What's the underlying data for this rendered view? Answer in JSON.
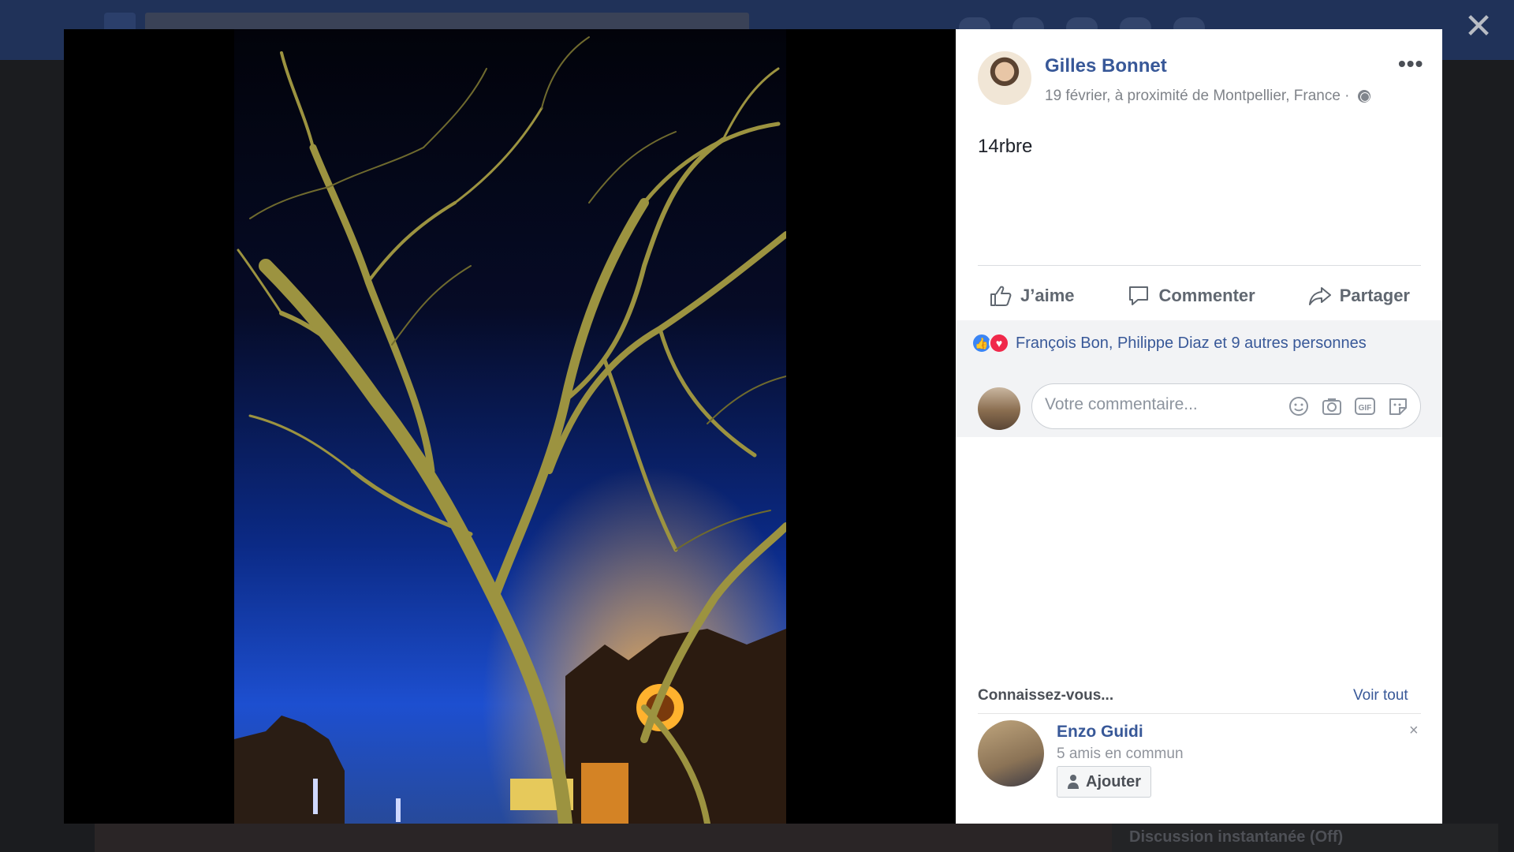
{
  "post": {
    "author": "Gilles Bonnet",
    "meta": "19 février, à proximité de Montpellier, France ·",
    "privacy_icon": "globe-icon",
    "caption": "14rbre",
    "more_icon": "•••"
  },
  "actions": {
    "like_label": "J’aime",
    "comment_label": "Commenter",
    "share_label": "Partager"
  },
  "reactions": {
    "icons": [
      "like-reaction-icon",
      "love-reaction-icon"
    ],
    "text": "François Bon, Philippe Diaz et 9 autres personnes"
  },
  "comment": {
    "placeholder": "Votre commentaire...",
    "icons": [
      "emoji-icon",
      "camera-icon",
      "gif-icon",
      "sticker-icon"
    ],
    "gif_text": "GIF"
  },
  "pymk": {
    "title": "Connaissez-vous...",
    "see_all": "Voir tout",
    "friend": {
      "name": "Enzo Guidi",
      "mutual": "5 amis en commun",
      "add_label": "Ajouter",
      "dismiss": "×"
    }
  },
  "chat_bar": {
    "label": "Discussion instantanée (Off)"
  },
  "close_symbol": "✕",
  "colors": {
    "link_blue": "#385898",
    "like_blue": "#3b85f4",
    "love_red": "#f0284a"
  }
}
